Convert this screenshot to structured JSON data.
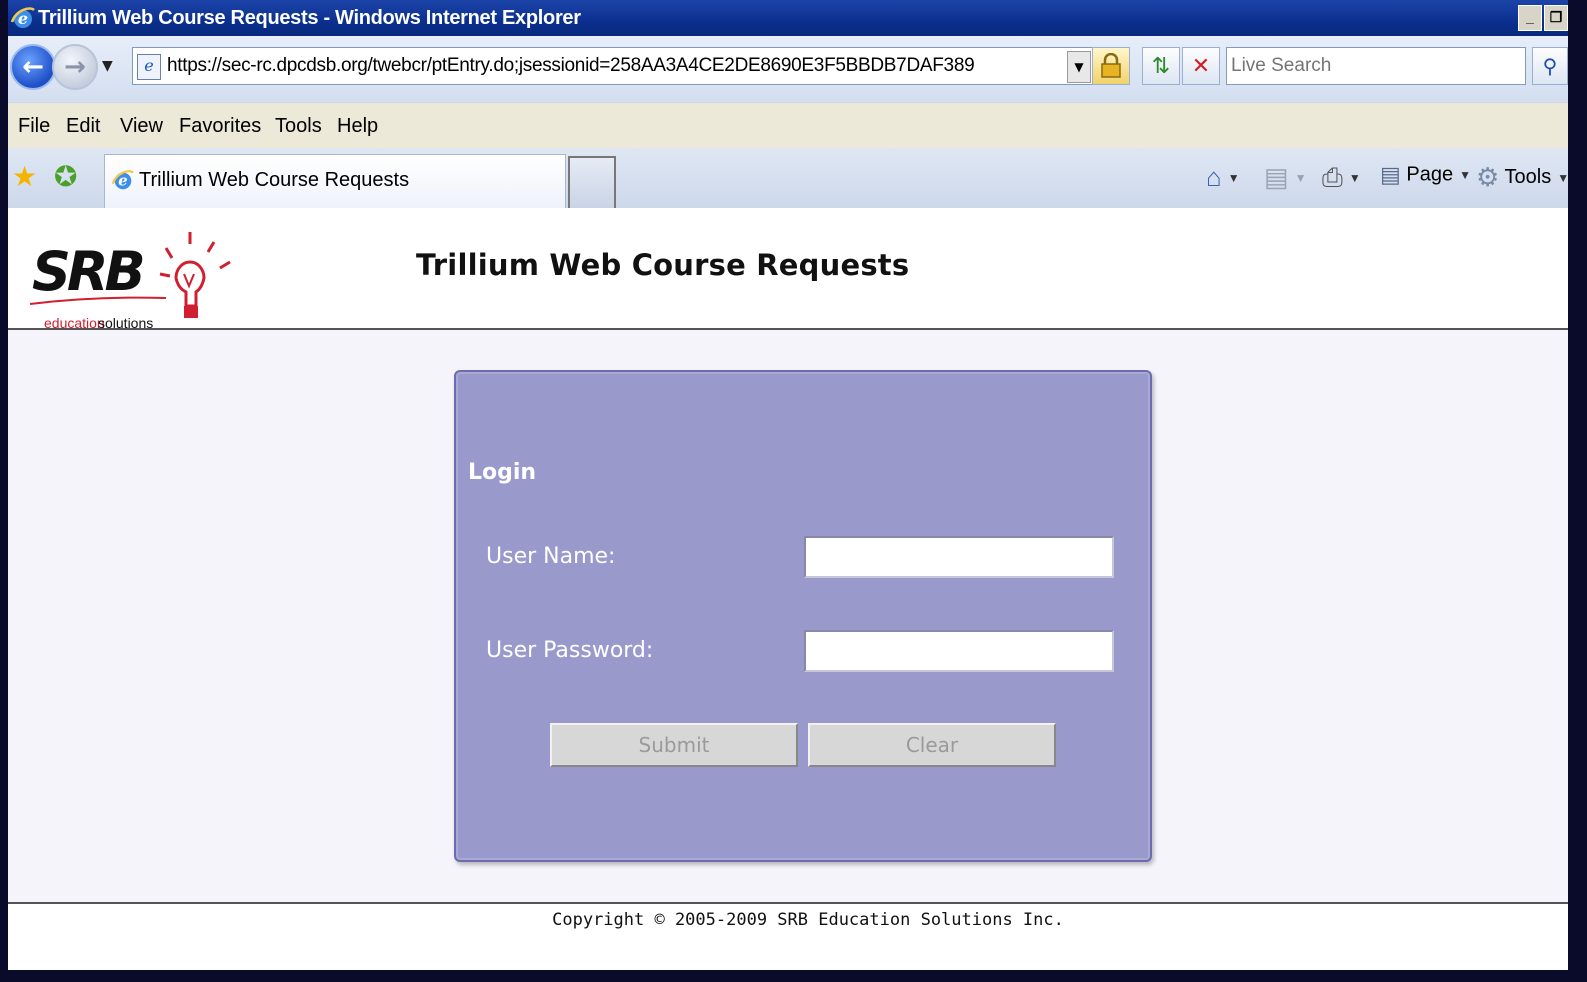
{
  "window": {
    "title": "Trillium Web Course Requests - Windows Internet Explorer",
    "minimize_glyph": "_",
    "restore_glyph": "❐"
  },
  "address_bar": {
    "url": "https://sec-rc.dpcdsb.org/twebcr/ptEntry.do;jsessionid=258AA3A4CE2DE8690E3F5BBDB7DAF389",
    "search_placeholder": "Live Search"
  },
  "menu": {
    "items": [
      "File",
      "Edit",
      "View",
      "Favorites",
      "Tools",
      "Help"
    ]
  },
  "tabs": {
    "active_label": "Trillium Web Course Requests"
  },
  "command_bar": {
    "page_label": "Page",
    "tools_label": "Tools"
  },
  "header": {
    "logo_text": "SRB",
    "logo_subtext_1": "education",
    "logo_subtext_2": "solutions",
    "title": "Trillium Web Course Requests"
  },
  "login": {
    "title": "Login",
    "username_label": "User Name:",
    "password_label": "User Password:",
    "username_value": "",
    "password_value": "",
    "submit_label": "Submit",
    "clear_label": "Clear"
  },
  "footer": {
    "copyright": "Copyright © 2005-2009 SRB Education Solutions Inc."
  },
  "colors": {
    "panel_bg": "#9999cb",
    "content_bg": "#f5f4fb",
    "titlebar": "#0b2f8f",
    "logo_red": "#d01f2f"
  },
  "icons": [
    "ie-icon",
    "back-arrow-icon",
    "forward-arrow-icon",
    "page-icon",
    "lock-icon",
    "refresh-icon",
    "stop-icon",
    "search-icon",
    "favorites-star-icon",
    "add-favorites-icon",
    "home-icon",
    "feeds-icon",
    "print-icon",
    "page-menu-icon",
    "tools-gear-icon",
    "lightbulb-icon"
  ]
}
